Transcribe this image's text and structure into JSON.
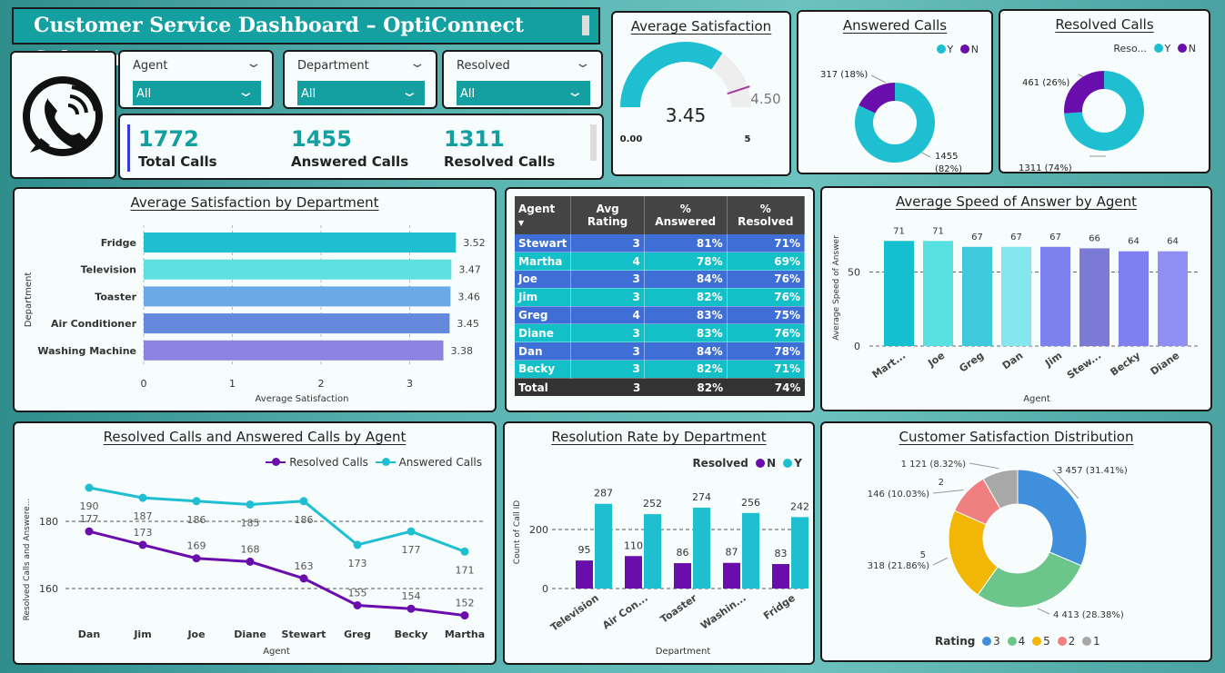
{
  "header": {
    "title": "Customer Service Dashboard – OptiConnect Solutions"
  },
  "filters": [
    {
      "label": "Agent",
      "value": "All"
    },
    {
      "label": "Department",
      "value": "All"
    },
    {
      "label": "Resolved",
      "value": "All"
    }
  ],
  "kpis": [
    {
      "value": "1772",
      "label": "Total Calls"
    },
    {
      "value": "1455",
      "label": "Answered Calls"
    },
    {
      "value": "1311",
      "label": "Resolved Calls"
    }
  ],
  "colors": {
    "teal": "#14a0a0",
    "cyan": "#1ebfd0",
    "purple": "#6a0dad",
    "banner": "#14a0a0"
  },
  "icons": {
    "logo": "phone-icon",
    "dropdown": "chevron-down-icon"
  },
  "satisfaction_gauge": {
    "title": "Average Satisfaction",
    "value": 3.45,
    "value_label": "3.45",
    "min_label": "0.00",
    "max_label": "5",
    "target_label": "4.50",
    "min": 0,
    "max": 5,
    "target": 4.5
  },
  "answered_donut": {
    "title": "Answered Calls",
    "legend": [
      "Y",
      "N"
    ],
    "slices": [
      {
        "name": "Y",
        "value": 1455,
        "label_a": "1455",
        "label_b": "(82%)"
      },
      {
        "name": "N",
        "value": 317,
        "label": "317 (18%)"
      }
    ]
  },
  "resolved_donut": {
    "title": "Resolved Calls",
    "legend_title": "Reso...",
    "legend": [
      "Y",
      "N"
    ],
    "slices": [
      {
        "name": "Y",
        "value": 1311,
        "label": "1311 (74%)"
      },
      {
        "name": "N",
        "value": 461,
        "label": "461 (26%)"
      }
    ]
  },
  "dept_satisfaction": {
    "title": "Average Satisfaction by Department",
    "ylabel": "Department",
    "xlabel": "Average Satisfaction",
    "ticks": [
      "0",
      "1",
      "2",
      "3"
    ],
    "chart_data": {
      "type": "bar",
      "categories": [
        "Fridge",
        "Television",
        "Toaster",
        "Air Conditioner",
        "Washing Machine"
      ],
      "values": [
        3.52,
        3.47,
        3.46,
        3.45,
        3.38
      ],
      "value_labels": [
        "3.52",
        "3.47",
        "3.46",
        "3.45",
        "3.38"
      ],
      "xlim": [
        0,
        3.6
      ]
    }
  },
  "agent_table": {
    "headers": [
      "Agent",
      "Avg Rating",
      "% Answered",
      "% Resolved"
    ],
    "rows": [
      [
        "Stewart",
        "3",
        "81%",
        "71%"
      ],
      [
        "Martha",
        "4",
        "78%",
        "69%"
      ],
      [
        "Joe",
        "3",
        "84%",
        "76%"
      ],
      [
        "Jim",
        "3",
        "82%",
        "76%"
      ],
      [
        "Greg",
        "4",
        "83%",
        "75%"
      ],
      [
        "Diane",
        "3",
        "83%",
        "76%"
      ],
      [
        "Dan",
        "3",
        "84%",
        "78%"
      ],
      [
        "Becky",
        "3",
        "82%",
        "71%"
      ]
    ],
    "total": [
      "Total",
      "3",
      "82%",
      "74%"
    ]
  },
  "speed_answer": {
    "title": "Average Speed of Answer by Agent",
    "ylabel": "Average Speed of Answer",
    "xlabel": "Agent",
    "yticks": [
      "0",
      "50"
    ],
    "chart_data": {
      "type": "bar",
      "categories": [
        "Mart...",
        "Joe",
        "Greg",
        "Dan",
        "Jim",
        "Stew...",
        "Becky",
        "Diane"
      ],
      "values": [
        71,
        71,
        67,
        67,
        67,
        66,
        64,
        64
      ],
      "ylim": [
        0,
        80
      ]
    }
  },
  "resolved_answered": {
    "title": "Resolved Calls and Answered Calls by Agent",
    "legend": [
      "Resolved Calls",
      "Answered Calls"
    ],
    "ylabel": "Resolved Calls and Answere...",
    "xlabel": "Agent",
    "yticks": [
      "160",
      "180"
    ],
    "chart_data": {
      "type": "line",
      "categories": [
        "Dan",
        "Jim",
        "Joe",
        "Diane",
        "Stewart",
        "Greg",
        "Becky",
        "Martha"
      ],
      "series": [
        {
          "name": "Resolved Calls",
          "values": [
            177,
            173,
            169,
            168,
            163,
            155,
            154,
            152
          ]
        },
        {
          "name": "Answered Calls",
          "values": [
            190,
            187,
            186,
            185,
            186,
            173,
            177,
            171
          ]
        }
      ],
      "ylim": [
        148,
        192
      ]
    }
  },
  "resolution_rate": {
    "title": "Resolution Rate by Department",
    "legend_title": "Resolved",
    "legend": [
      "N",
      "Y"
    ],
    "ylabel": "Count of Call ID",
    "xlabel": "Department",
    "yticks": [
      "0",
      "200"
    ],
    "chart_data": {
      "type": "bar",
      "categories": [
        "Television",
        "Air Con...",
        "Toaster",
        "Washin...",
        "Fridge"
      ],
      "series": [
        {
          "name": "N",
          "values": [
            95,
            110,
            86,
            87,
            83
          ]
        },
        {
          "name": "Y",
          "values": [
            287,
            252,
            274,
            256,
            242
          ]
        }
      ],
      "ylim": [
        0,
        300
      ]
    }
  },
  "satisfaction_dist": {
    "title": "Customer Satisfaction Distribution",
    "legend_title": "Rating",
    "legend": [
      "3",
      "4",
      "5",
      "2",
      "1"
    ],
    "chart_data": {
      "type": "pie",
      "categories": [
        "3",
        "4",
        "5",
        "2",
        "1"
      ],
      "values": [
        3457,
        4413,
        318,
        146,
        1121
      ],
      "labels": [
        "3 457 (31.41%)",
        "4 413 (28.38%)",
        "318 (21.86%)",
        "146 (10.03%)",
        "1 121 (8.32%)"
      ],
      "shares": [
        31.41,
        28.38,
        21.86,
        10.03,
        8.32
      ],
      "colors": [
        "#3f8fdc",
        "#6cc58a",
        "#f2b705",
        "#f08080",
        "#a8a8a8"
      ],
      "side_labels": [
        "5",
        "2"
      ]
    }
  }
}
